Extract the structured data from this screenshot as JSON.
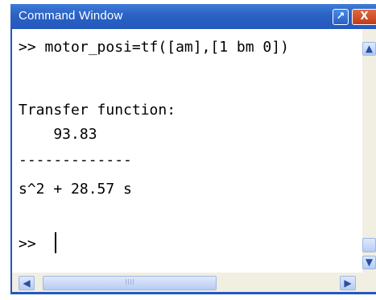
{
  "window": {
    "title": "Command Window",
    "buttons": {
      "undock": "↗",
      "close": "X"
    }
  },
  "console": {
    "lines": [
      ">> motor_posi=tf([am],[1 bm 0])",
      "Transfer function:",
      "    93.83",
      "-------------",
      "s^2 + 28.57 s",
      ">> "
    ]
  },
  "scrollbars": {
    "up": "▲",
    "down": "▼",
    "left": "◀",
    "right": "▶",
    "grip": "IIII"
  },
  "colors": {
    "titlebar": "#2a62c4",
    "close_button": "#c13c1a",
    "scroll_track": "#f1efe2"
  }
}
